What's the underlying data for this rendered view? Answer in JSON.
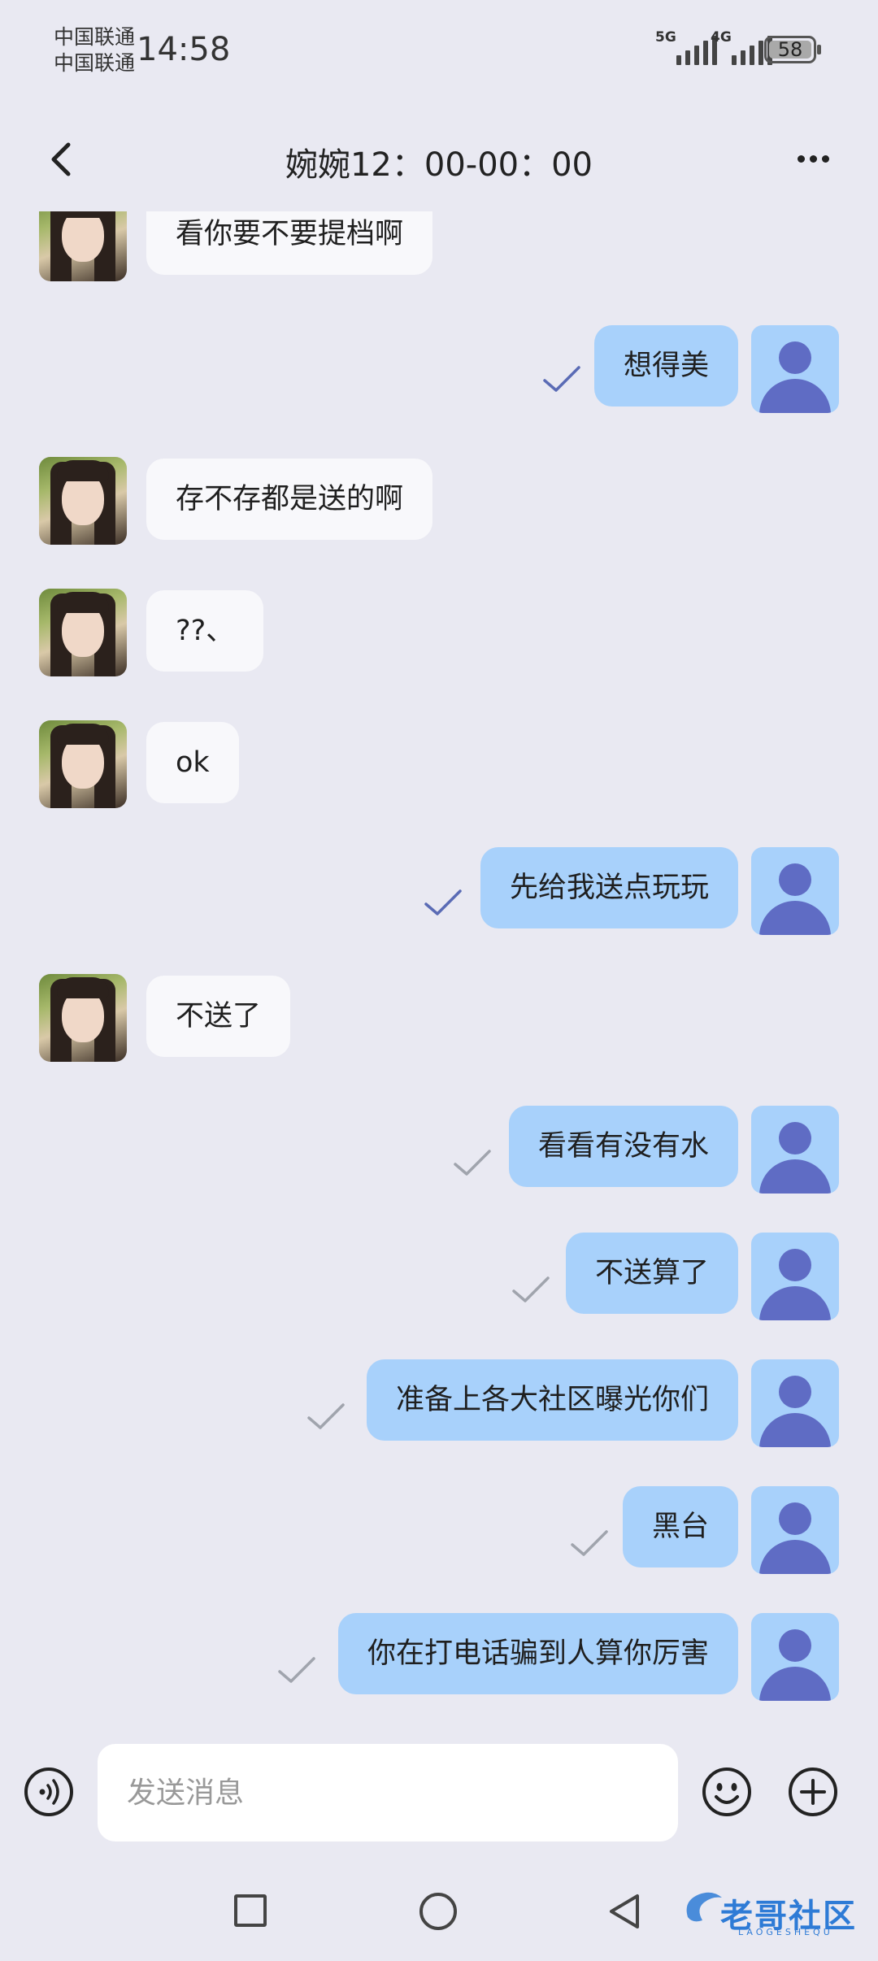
{
  "status_bar": {
    "carrier_1": "中国联通",
    "carrier_2": "中国联通",
    "time": "14:58",
    "signal_1_label": "5G",
    "signal_2_label": "4G",
    "battery": "58"
  },
  "header": {
    "title": "婉婉12：00-00：00"
  },
  "messages": [
    {
      "side": "in",
      "text": "看你要不要提档啊"
    },
    {
      "side": "out",
      "text": "想得美",
      "read": true
    },
    {
      "side": "in",
      "text": "存不存都是送的啊"
    },
    {
      "side": "in",
      "text": "??、"
    },
    {
      "side": "in",
      "text": "ok"
    },
    {
      "side": "out",
      "text": "先给我送点玩玩",
      "read": true
    },
    {
      "side": "in",
      "text": "不送了"
    },
    {
      "side": "out",
      "text": "看看有没有水",
      "read": false
    },
    {
      "side": "out",
      "text": "不送算了",
      "read": false
    },
    {
      "side": "out",
      "text": "准备上各大社区曝光你们",
      "read": false
    },
    {
      "side": "out",
      "text": "黑台",
      "read": false
    },
    {
      "side": "out",
      "text": "你在打电话骗到人算你厉害",
      "read": false
    }
  ],
  "input": {
    "placeholder": "发送消息"
  },
  "watermark": {
    "text": "老哥社区",
    "sub": "LAOGESHEQU"
  },
  "colors": {
    "background": "#e9e9f2",
    "out_bubble": "#a8d1fb",
    "in_bubble": "#f8f8fb",
    "read_check": "#5a6bb5",
    "unread_check": "#a0a4ad"
  }
}
